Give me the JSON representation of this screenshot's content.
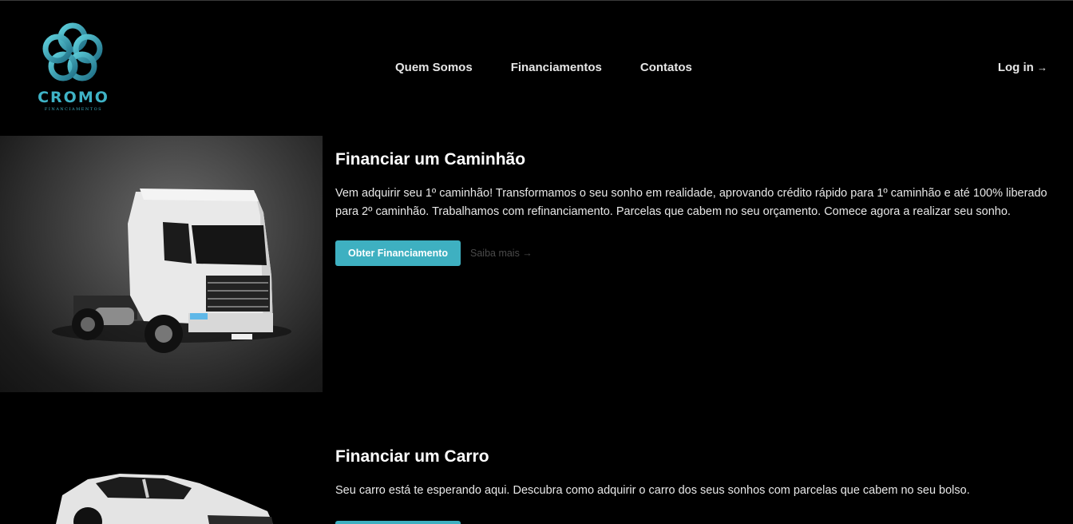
{
  "brand": {
    "name": "CROMO",
    "subtitle": "FINANCIAMENTOS",
    "color": "#3fb3c6"
  },
  "nav": {
    "items": [
      "Quem Somos",
      "Financiamentos",
      "Contatos"
    ],
    "login_label": "Log in",
    "login_arrow": "→"
  },
  "sections": [
    {
      "title": "Financiar um Caminhão",
      "text": "Vem adquirir seu 1º caminhão! Transformamos o seu sonho em realidade, aprovando crédito rápido para 1º caminhão e até 100% liberado para 2º caminhão. Trabalhamos com refinanciamento. Parcelas que cabem no seu orçamento. Comece agora a realizar seu sonho.",
      "cta_label": "Obter Financiamento",
      "more_label": "Saiba mais →",
      "image": "truck"
    },
    {
      "title": "Financiar um Carro",
      "text": "Seu carro está te esperando aqui. Descubra como adquirir o carro dos seus sonhos com parcelas que cabem no seu bolso.",
      "image": "car"
    }
  ],
  "colors": {
    "accent": "#3eb0c1",
    "background": "#000000"
  }
}
